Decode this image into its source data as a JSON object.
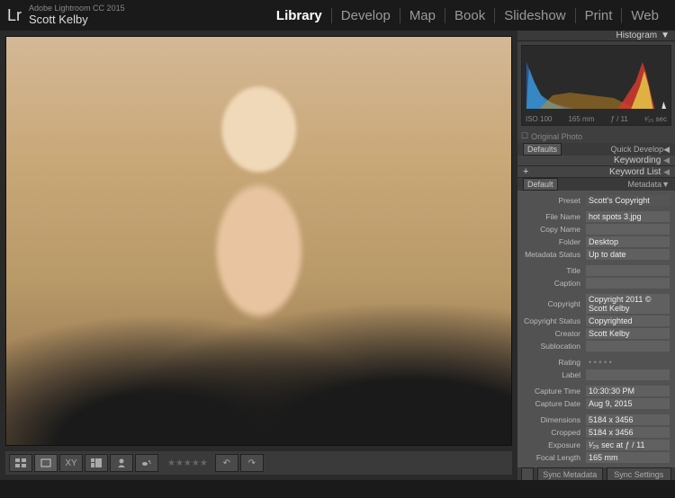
{
  "header": {
    "app_title": "Adobe Lightroom CC 2015",
    "user_name": "Scott Kelby",
    "logo": "Lr"
  },
  "modules": [
    "Library",
    "Develop",
    "Map",
    "Book",
    "Slideshow",
    "Print",
    "Web"
  ],
  "active_module": "Library",
  "panels": {
    "histogram": {
      "title": "Histogram",
      "iso": "ISO 100",
      "focal": "165 mm",
      "aperture": "ƒ / 11",
      "shutter": "¹⁄₂₅ sec",
      "original": "Original Photo"
    },
    "quick_develop": {
      "title": "Quick Develop",
      "defaults": "Defaults"
    },
    "keywording": {
      "title": "Keywording"
    },
    "keyword_list": {
      "title": "Keyword List"
    },
    "metadata": {
      "title": "Metadata",
      "mode": "Default",
      "preset_label": "Preset",
      "preset_value": "Scott's Copyright",
      "rows": [
        {
          "label": "File Name",
          "value": "hot spots 3.jpg"
        },
        {
          "label": "Copy Name",
          "value": ""
        },
        {
          "label": "Folder",
          "value": "Desktop"
        },
        {
          "label": "Metadata Status",
          "value": "Up to date"
        }
      ],
      "rows2": [
        {
          "label": "Title",
          "value": ""
        },
        {
          "label": "Caption",
          "value": ""
        }
      ],
      "rows3": [
        {
          "label": "Copyright",
          "value": "Copyright 2011 © Scott Kelby"
        },
        {
          "label": "Copyright Status",
          "value": "Copyrighted"
        },
        {
          "label": "Creator",
          "value": "Scott Kelby"
        },
        {
          "label": "Sublocation",
          "value": ""
        }
      ],
      "rating_label": "Rating",
      "label_label": "Label",
      "rows4": [
        {
          "label": "Capture Time",
          "value": "10:30:30 PM"
        },
        {
          "label": "Capture Date",
          "value": "Aug 9, 2015"
        }
      ],
      "rows5": [
        {
          "label": "Dimensions",
          "value": "5184 x 3456"
        },
        {
          "label": "Cropped",
          "value": "5184 x 3456"
        },
        {
          "label": "Exposure",
          "value": "¹⁄₂₅ sec at ƒ / 11"
        },
        {
          "label": "Focal Length",
          "value": "165 mm"
        }
      ]
    }
  },
  "sync": {
    "metadata": "Sync Metadata",
    "settings": "Sync Settings"
  },
  "toolbar": {
    "stars": "★★★★★"
  }
}
